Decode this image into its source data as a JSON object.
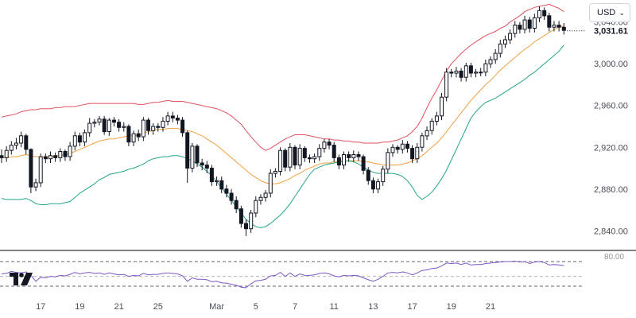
{
  "currency_selector": {
    "label": "USD",
    "chevron_icon": "chevron-down-icon"
  },
  "logo": {
    "icon": "tradingview-logo-icon"
  },
  "colors": {
    "bullish": "#ffffff",
    "bearish": "#131722",
    "wick": "#131722",
    "bb_upper": "#e05260",
    "bb_middle": "#f0a040",
    "bb_lower": "#26a48a",
    "rsi_line": "#7e57c2",
    "grid_dashed": "#5d606b",
    "separator": "#000000"
  },
  "chart_data": {
    "type": "candlestick",
    "title": "",
    "xlabel": "",
    "ylabel": "",
    "ylim": [
      2825,
      3055
    ],
    "y_ticks": [
      "3,040.00",
      "3,000.00",
      "2,960.00",
      "2,920.00",
      "2,880.00",
      "2,840.00"
    ],
    "y_tick_values": [
      3040,
      3000,
      2960,
      2920,
      2880,
      2840
    ],
    "x_tick_labels": [
      "17",
      "19",
      "21",
      "25",
      "Mar",
      "5",
      "7",
      "11",
      "13",
      "17",
      "19",
      "21"
    ],
    "x_tick_positions": [
      8,
      16,
      24,
      32,
      44,
      52,
      60,
      68,
      76,
      84,
      92,
      100
    ],
    "last_price": 3031.61,
    "last_price_label": "3,031.61",
    "candles": {
      "open": [
        2912,
        2910,
        2917,
        2922,
        2924,
        2931,
        2918,
        2882,
        2886,
        2911,
        2909,
        2912,
        2910,
        2916,
        2911,
        2921,
        2931,
        2925,
        2934,
        2943,
        2944,
        2947,
        2935,
        2946,
        2944,
        2939,
        2940,
        2925,
        2933,
        2930,
        2946,
        2936,
        2940,
        2939,
        2945,
        2950,
        2948,
        2946,
        2934,
        2900,
        2921,
        2905,
        2903,
        2900,
        2887,
        2888,
        2880,
        2876,
        2869,
        2861,
        2847,
        2842,
        2857,
        2869,
        2872,
        2876,
        2895,
        2897,
        2917,
        2901,
        2920,
        2903,
        2919,
        2910,
        2909,
        2911,
        2919,
        2925,
        2922,
        2910,
        2903,
        2913,
        2910,
        2913,
        2911,
        2898,
        2888,
        2880,
        2887,
        2899,
        2915,
        2920,
        2918,
        2923,
        2919,
        2909,
        2920,
        2931,
        2936,
        2945,
        2950,
        2968,
        2992,
        2991,
        2993,
        2987,
        2998,
        2991,
        2992,
        2992,
        3000,
        3004,
        3010,
        3019,
        3023,
        3029,
        3037,
        3033,
        3042,
        3034,
        3044,
        3051,
        3046,
        3035,
        3037,
        3035
      ],
      "close": [
        2910,
        2917,
        2922,
        2924,
        2931,
        2918,
        2882,
        2886,
        2911,
        2909,
        2912,
        2910,
        2916,
        2911,
        2921,
        2931,
        2925,
        2934,
        2943,
        2944,
        2947,
        2935,
        2946,
        2944,
        2939,
        2940,
        2925,
        2933,
        2930,
        2946,
        2936,
        2940,
        2939,
        2945,
        2950,
        2948,
        2946,
        2934,
        2900,
        2921,
        2905,
        2903,
        2900,
        2887,
        2888,
        2880,
        2876,
        2869,
        2861,
        2847,
        2842,
        2857,
        2869,
        2872,
        2876,
        2895,
        2897,
        2917,
        2901,
        2920,
        2903,
        2919,
        2910,
        2909,
        2911,
        2919,
        2925,
        2922,
        2910,
        2903,
        2913,
        2910,
        2913,
        2911,
        2898,
        2888,
        2880,
        2887,
        2899,
        2915,
        2920,
        2918,
        2923,
        2919,
        2909,
        2920,
        2931,
        2936,
        2945,
        2950,
        2968,
        2992,
        2991,
        2993,
        2987,
        2998,
        2991,
        2992,
        2992,
        3000,
        3004,
        3010,
        3019,
        3023,
        3029,
        3037,
        3033,
        3042,
        3034,
        3044,
        3051,
        3046,
        3035,
        3037,
        3035,
        3032
      ],
      "high": [
        2918,
        2921,
        2926,
        2929,
        2935,
        2933,
        2919,
        2890,
        2914,
        2914,
        2916,
        2915,
        2919,
        2918,
        2925,
        2935,
        2934,
        2937,
        2948,
        2947,
        2950,
        2950,
        2948,
        2949,
        2947,
        2944,
        2942,
        2936,
        2937,
        2949,
        2948,
        2943,
        2943,
        2949,
        2954,
        2954,
        2951,
        2949,
        2936,
        2924,
        2923,
        2909,
        2907,
        2903,
        2892,
        2892,
        2884,
        2880,
        2873,
        2864,
        2851,
        2860,
        2873,
        2875,
        2879,
        2899,
        2900,
        2920,
        2919,
        2924,
        2922,
        2923,
        2921,
        2913,
        2914,
        2923,
        2928,
        2928,
        2925,
        2913,
        2916,
        2916,
        2917,
        2916,
        2913,
        2901,
        2891,
        2890,
        2902,
        2919,
        2923,
        2922,
        2927,
        2926,
        2922,
        2924,
        2934,
        2940,
        2948,
        2954,
        2972,
        2996,
        2995,
        2997,
        2996,
        3001,
        3001,
        2995,
        2996,
        3004,
        3007,
        3014,
        3023,
        3027,
        3033,
        3041,
        3040,
        3046,
        3045,
        3048,
        3055,
        3054,
        3049,
        3041,
        3041,
        3039
      ],
      "low": [
        2905,
        2906,
        2913,
        2918,
        2920,
        2913,
        2876,
        2878,
        2882,
        2905,
        2905,
        2906,
        2906,
        2907,
        2907,
        2917,
        2921,
        2921,
        2930,
        2939,
        2941,
        2932,
        2931,
        2940,
        2935,
        2935,
        2921,
        2921,
        2926,
        2926,
        2932,
        2932,
        2935,
        2935,
        2941,
        2944,
        2942,
        2930,
        2886,
        2896,
        2901,
        2898,
        2895,
        2883,
        2883,
        2876,
        2872,
        2865,
        2857,
        2843,
        2835,
        2838,
        2853,
        2865,
        2868,
        2872,
        2891,
        2893,
        2897,
        2897,
        2899,
        2899,
        2906,
        2905,
        2905,
        2907,
        2915,
        2918,
        2906,
        2899,
        2899,
        2906,
        2906,
        2907,
        2894,
        2884,
        2876,
        2876,
        2883,
        2895,
        2911,
        2914,
        2914,
        2915,
        2905,
        2905,
        2916,
        2927,
        2932,
        2941,
        2946,
        2964,
        2987,
        2987,
        2983,
        2983,
        2987,
        2987,
        2988,
        2988,
        2996,
        3000,
        3006,
        3015,
        3019,
        3025,
        3029,
        3029,
        3030,
        3030,
        3040,
        3042,
        3031,
        3031,
        3031,
        3028
      ]
    },
    "bollinger_bands": {
      "upper": [
        2949,
        2950,
        2951,
        2952,
        2954,
        2955,
        2956,
        2956,
        2957,
        2957,
        2957,
        2958,
        2958,
        2959,
        2959,
        2959,
        2960,
        2961,
        2962,
        2962,
        2962,
        2962,
        2962,
        2962,
        2962,
        2962,
        2962,
        2962,
        2961,
        2961,
        2962,
        2963,
        2963,
        2964,
        2965,
        2964,
        2964,
        2964,
        2963,
        2962,
        2961,
        2960,
        2959,
        2958,
        2957,
        2955,
        2953,
        2950,
        2946,
        2942,
        2936,
        2930,
        2925,
        2920,
        2917,
        2919,
        2922,
        2925,
        2928,
        2930,
        2932,
        2932,
        2932,
        2931,
        2930,
        2929,
        2928,
        2928,
        2927,
        2927,
        2926,
        2926,
        2925,
        2925,
        2924,
        2924,
        2924,
        2924,
        2925,
        2925,
        2926,
        2927,
        2929,
        2931,
        2935,
        2940,
        2948,
        2958,
        2967,
        2975,
        2984,
        2993,
        3000,
        3005,
        3010,
        3014,
        3018,
        3021,
        3024,
        3027,
        3029,
        3031,
        3034,
        3036,
        3040,
        3043,
        3046,
        3050,
        3052,
        3054,
        3055,
        3056,
        3057,
        3055,
        3053,
        3050
      ],
      "middle": [
        2910,
        2910,
        2911,
        2911,
        2912,
        2913,
        2912,
        2911,
        2911,
        2911,
        2911,
        2912,
        2912,
        2913,
        2914,
        2916,
        2918,
        2920,
        2922,
        2924,
        2926,
        2927,
        2928,
        2928,
        2929,
        2930,
        2931,
        2931,
        2932,
        2933,
        2935,
        2936,
        2937,
        2937,
        2938,
        2938,
        2938,
        2937,
        2936,
        2935,
        2933,
        2931,
        2928,
        2925,
        2922,
        2918,
        2914,
        2910,
        2906,
        2902,
        2898,
        2894,
        2891,
        2888,
        2886,
        2885,
        2885,
        2886,
        2888,
        2890,
        2893,
        2895,
        2898,
        2900,
        2902,
        2904,
        2905,
        2905,
        2906,
        2906,
        2906,
        2907,
        2907,
        2907,
        2906,
        2906,
        2905,
        2904,
        2903,
        2903,
        2903,
        2903,
        2904,
        2905,
        2907,
        2909,
        2912,
        2916,
        2920,
        2924,
        2929,
        2935,
        2941,
        2947,
        2953,
        2959,
        2965,
        2970,
        2975,
        2980,
        2984,
        2989,
        2994,
        2998,
        3002,
        3006,
        3010,
        3014,
        3017,
        3021,
        3024,
        3027,
        3030,
        3033,
        3035,
        3036
      ],
      "lower": [
        2871,
        2870,
        2870,
        2870,
        2870,
        2871,
        2869,
        2866,
        2865,
        2865,
        2866,
        2866,
        2866,
        2867,
        2868,
        2872,
        2876,
        2879,
        2882,
        2885,
        2889,
        2891,
        2894,
        2895,
        2896,
        2897,
        2899,
        2900,
        2902,
        2904,
        2907,
        2909,
        2910,
        2911,
        2911,
        2912,
        2912,
        2911,
        2909,
        2907,
        2904,
        2901,
        2897,
        2893,
        2887,
        2881,
        2875,
        2869,
        2863,
        2857,
        2851,
        2847,
        2844,
        2843,
        2844,
        2847,
        2851,
        2855,
        2860,
        2866,
        2873,
        2880,
        2887,
        2894,
        2899,
        2901,
        2903,
        2904,
        2905,
        2906,
        2907,
        2907,
        2906,
        2904,
        2901,
        2898,
        2896,
        2895,
        2895,
        2895,
        2895,
        2894,
        2892,
        2888,
        2882,
        2874,
        2870,
        2873,
        2877,
        2883,
        2890,
        2898,
        2908,
        2918,
        2928,
        2938,
        2948,
        2954,
        2959,
        2963,
        2965,
        2967,
        2970,
        2973,
        2976,
        2979,
        2982,
        2985,
        2989,
        2992,
        2996,
        3000,
        3004,
        3008,
        3012,
        3018
      ]
    },
    "rsi": {
      "level_label": "80.00",
      "upper_level": 80,
      "lower_level": 30,
      "mid_level": 50,
      "values": [
        55,
        56,
        60,
        58,
        57,
        59,
        52,
        40,
        48,
        47,
        50,
        49,
        52,
        51,
        54,
        58,
        55,
        57,
        58,
        56,
        57,
        54,
        57,
        55,
        53,
        54,
        50,
        52,
        51,
        56,
        53,
        54,
        54,
        56,
        57,
        56,
        55,
        51,
        40,
        47,
        44,
        44,
        43,
        39,
        40,
        37,
        36,
        34,
        32,
        28,
        27,
        35,
        41,
        42,
        44,
        51,
        52,
        58,
        50,
        57,
        50,
        55,
        52,
        52,
        53,
        56,
        57,
        55,
        51,
        49,
        52,
        51,
        52,
        51,
        47,
        43,
        40,
        44,
        50,
        57,
        58,
        57,
        59,
        57,
        53,
        57,
        62,
        63,
        66,
        67,
        71,
        77,
        76,
        77,
        74,
        77,
        73,
        74,
        74,
        76,
        77,
        78,
        79,
        80,
        80,
        81,
        79,
        80,
        76,
        79,
        80,
        78,
        73,
        74,
        73,
        72
      ]
    }
  }
}
